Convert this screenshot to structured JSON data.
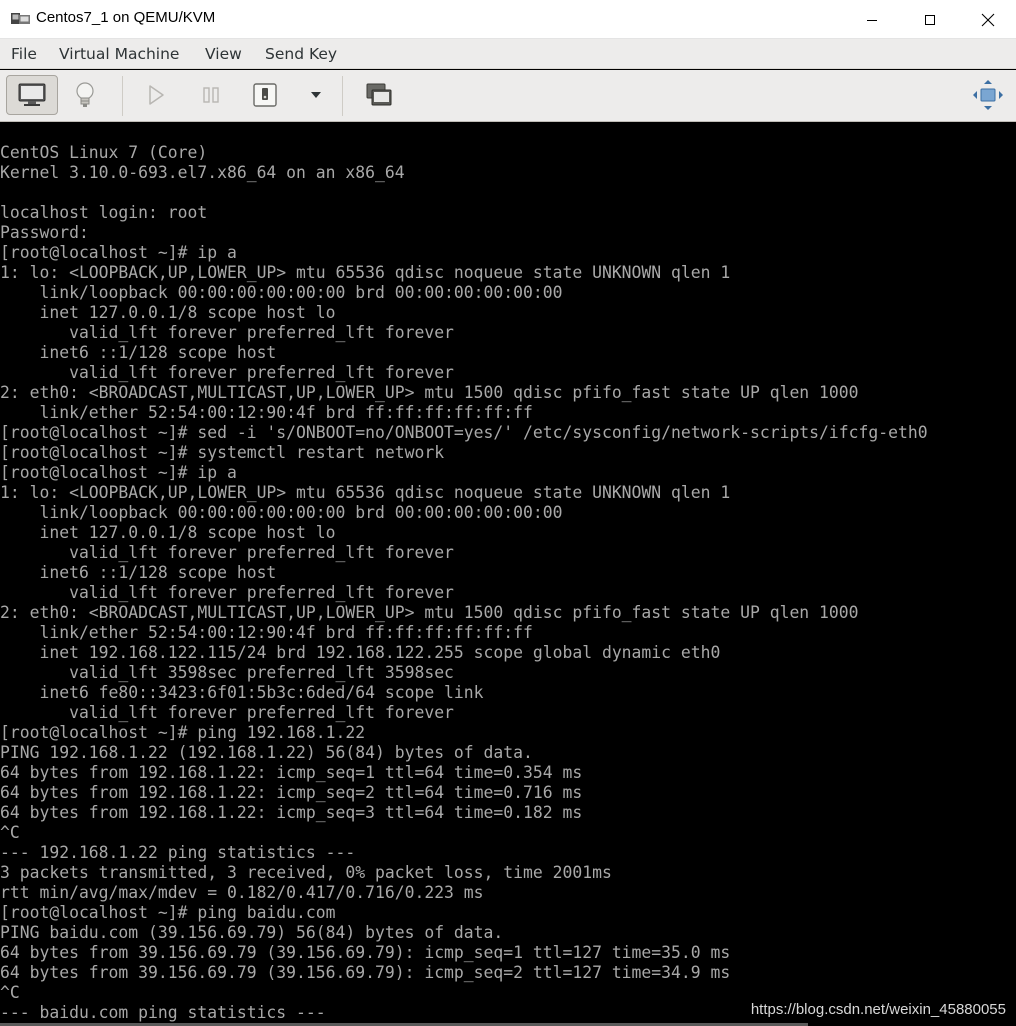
{
  "window": {
    "title": "Centos7_1 on QEMU/KVM",
    "minimize_label": "—",
    "maximize_label": "☐",
    "close_label": "✕"
  },
  "menubar": {
    "items": [
      "File",
      "Virtual Machine",
      "View",
      "Send Key"
    ]
  },
  "toolbar": {
    "icons": [
      "console-icon",
      "details-icon",
      "run-icon",
      "pause-icon",
      "shutdown-icon",
      "dropdown-arrow-icon",
      "snapshot-icon",
      "fullscreen-icon"
    ],
    "console_active": true
  },
  "console": {
    "lines": [
      "CentOS Linux 7 (Core)",
      "Kernel 3.10.0-693.el7.x86_64 on an x86_64",
      "",
      "localhost login: root",
      "Password:",
      "[root@localhost ~]# ip a",
      "1: lo: <LOOPBACK,UP,LOWER_UP> mtu 65536 qdisc noqueue state UNKNOWN qlen 1",
      "    link/loopback 00:00:00:00:00:00 brd 00:00:00:00:00:00",
      "    inet 127.0.0.1/8 scope host lo",
      "       valid_lft forever preferred_lft forever",
      "    inet6 ::1/128 scope host",
      "       valid_lft forever preferred_lft forever",
      "2: eth0: <BROADCAST,MULTICAST,UP,LOWER_UP> mtu 1500 qdisc pfifo_fast state UP qlen 1000",
      "    link/ether 52:54:00:12:90:4f brd ff:ff:ff:ff:ff:ff",
      "[root@localhost ~]# sed -i 's/ONBOOT=no/ONBOOT=yes/' /etc/sysconfig/network-scripts/ifcfg-eth0",
      "[root@localhost ~]# systemctl restart network",
      "[root@localhost ~]# ip a",
      "1: lo: <LOOPBACK,UP,LOWER_UP> mtu 65536 qdisc noqueue state UNKNOWN qlen 1",
      "    link/loopback 00:00:00:00:00:00 brd 00:00:00:00:00:00",
      "    inet 127.0.0.1/8 scope host lo",
      "       valid_lft forever preferred_lft forever",
      "    inet6 ::1/128 scope host",
      "       valid_lft forever preferred_lft forever",
      "2: eth0: <BROADCAST,MULTICAST,UP,LOWER_UP> mtu 1500 qdisc pfifo_fast state UP qlen 1000",
      "    link/ether 52:54:00:12:90:4f brd ff:ff:ff:ff:ff:ff",
      "    inet 192.168.122.115/24 brd 192.168.122.255 scope global dynamic eth0",
      "       valid_lft 3598sec preferred_lft 3598sec",
      "    inet6 fe80::3423:6f01:5b3c:6ded/64 scope link",
      "       valid_lft forever preferred_lft forever",
      "[root@localhost ~]# ping 192.168.1.22",
      "PING 192.168.1.22 (192.168.1.22) 56(84) bytes of data.",
      "64 bytes from 192.168.1.22: icmp_seq=1 ttl=64 time=0.354 ms",
      "64 bytes from 192.168.1.22: icmp_seq=2 ttl=64 time=0.716 ms",
      "64 bytes from 192.168.1.22: icmp_seq=3 ttl=64 time=0.182 ms",
      "^C",
      "--- 192.168.1.22 ping statistics ---",
      "3 packets transmitted, 3 received, 0% packet loss, time 2001ms",
      "rtt min/avg/max/mdev = 0.182/0.417/0.716/0.223 ms",
      "[root@localhost ~]# ping baidu.com",
      "PING baidu.com (39.156.69.79) 56(84) bytes of data.",
      "64 bytes from 39.156.69.79 (39.156.69.79): icmp_seq=1 ttl=127 time=35.0 ms",
      "64 bytes from 39.156.69.79 (39.156.69.79): icmp_seq=2 ttl=127 time=34.9 ms",
      "^C",
      "--- baidu.com ping statistics ---"
    ]
  },
  "watermark": "https://blog.csdn.net/weixin_45880055",
  "colors": {
    "console_bg": "#000000",
    "console_fg": "#a8a8a8",
    "chrome_bg": "#edeceb"
  }
}
